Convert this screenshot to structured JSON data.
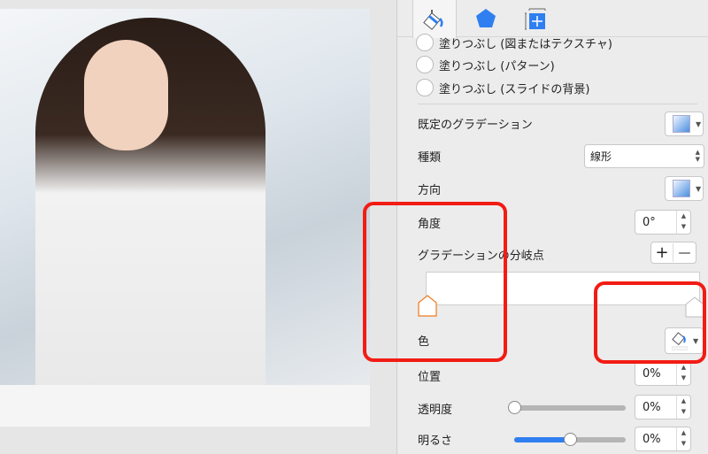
{
  "tabs": [
    {
      "icon": "paint-bucket-icon",
      "active": true
    },
    {
      "icon": "pentagon-shape-icon",
      "active": false
    },
    {
      "icon": "size-position-icon",
      "active": false
    }
  ],
  "fill_options": [
    {
      "label": "塗りつぶし (図またはテクスチャ)"
    },
    {
      "label": "塗りつぶし (パターン)"
    },
    {
      "label": "塗りつぶし (スライドの背景)"
    }
  ],
  "preset_gradient": {
    "label": "既定のグラデーション"
  },
  "type": {
    "label": "種類",
    "value": "線形"
  },
  "direction": {
    "label": "方向"
  },
  "angle": {
    "label": "角度",
    "value": "0°"
  },
  "gradient_stops": {
    "label": "グラデーションの分岐点",
    "add": "+",
    "remove": "—",
    "stop_positions": [
      0,
      100
    ],
    "selected_stop": 0,
    "selected_color": "#f07a1a"
  },
  "color": {
    "label": "色"
  },
  "position": {
    "label": "位置",
    "value": "0%"
  },
  "transparency": {
    "label": "透明度",
    "value": "0%",
    "slider": 0
  },
  "brightness": {
    "label": "明るさ",
    "value": "0%",
    "slider": 0.5
  },
  "annotation_color": "#f21c14",
  "accent_color": "#2f7ff0"
}
